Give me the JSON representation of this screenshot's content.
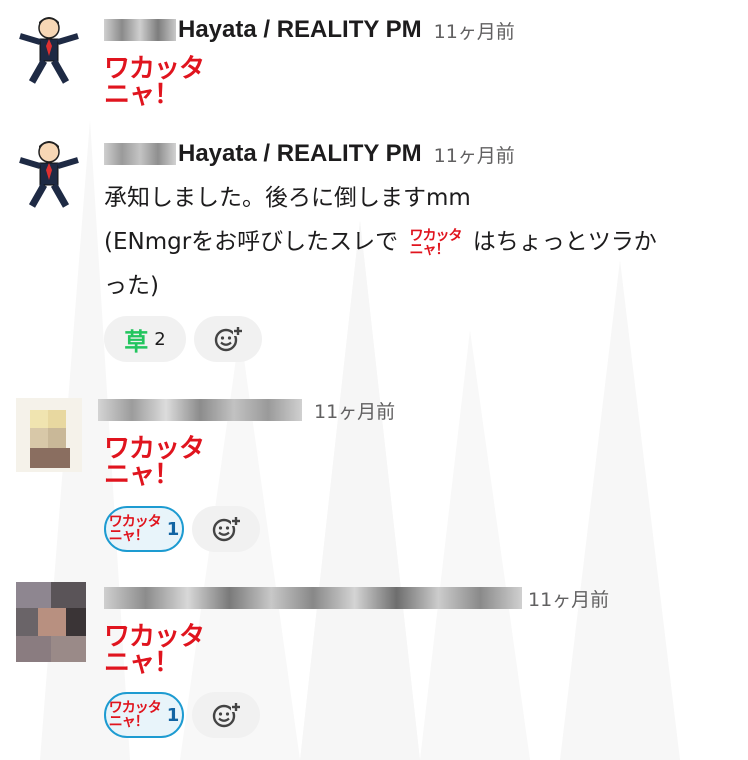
{
  "messages": [
    {
      "author": "Hayata / REALITY PM",
      "time": "11ヶ月前",
      "stamp": {
        "line1": "ワカッタ",
        "line2": "ニャ！"
      }
    },
    {
      "author": "Hayata / REALITY PM",
      "time": "11ヶ月前",
      "text_line1": "承知しました。後ろに倒しますmm",
      "text_line2_before": "(ENmgrをお呼びしたスレで",
      "text_line2_after": "はちょっとツラか",
      "text_line3": "った)",
      "inline_stamp": {
        "line1": "ワカッタ",
        "line2": "ニャ！"
      },
      "reactions": [
        {
          "emoji": "草",
          "count": "2"
        }
      ]
    },
    {
      "time": "11ヶ月前",
      "stamp": {
        "line1": "ワカッタ",
        "line2": "ニャ！"
      },
      "reactions": [
        {
          "emoji_line1": "ワカッタ",
          "emoji_line2": "ニャ！",
          "count": "1"
        }
      ]
    },
    {
      "time": "11ヶ月前",
      "stamp": {
        "line1": "ワカッタ",
        "line2": "ニャ！"
      },
      "reactions": [
        {
          "emoji_line1": "ワカッタ",
          "emoji_line2": "ニャ！",
          "count": "1"
        }
      ]
    }
  ],
  "colors": {
    "stamp_red": "#e0141e",
    "reaction_active_border": "#1d9bd1",
    "kusa_green": "#22c55e"
  },
  "icons": {
    "add_reaction": "add-reaction-icon",
    "avatar_businessman": "businessman-avatar-icon"
  }
}
